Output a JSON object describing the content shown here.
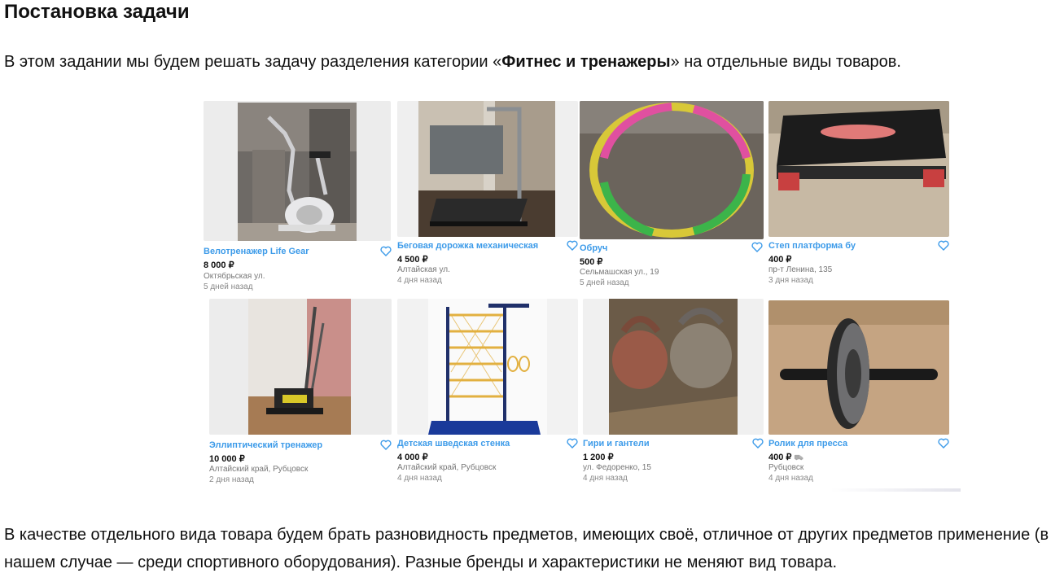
{
  "heading": "Постановка задачи",
  "intro": {
    "before": "В этом задании мы будем решать задачу разделения категории «",
    "bold": "Фитнес и тренажеры",
    "after": "» на отдельные виды товаров."
  },
  "outro": "В качестве отдельного вида товара будем брать разновидность предметов, имеющих своё, отличное от других предметов применение (в нашем случае — среди спортивного оборудования). Разные бренды и характеристики не меняют вид товара.",
  "currency": "₽",
  "listings": [
    {
      "title": "Велотренажер Life Gear",
      "price": "8 000 ₽",
      "address": "Октябрьская ул.",
      "date": "5 дней назад",
      "icon": "exercise-bike"
    },
    {
      "title": "Беговая дорожка механическая",
      "price": "4 500 ₽",
      "address": "Алтайская ул.",
      "date": "4 дня назад",
      "icon": "treadmill"
    },
    {
      "title": "Обруч",
      "price": "500 ₽",
      "address": "Сельмашская ул., 19",
      "date": "5 дней назад",
      "icon": "hula-hoop"
    },
    {
      "title": "Степ платформа бу",
      "price": "400 ₽",
      "address": "пр-т Ленина, 135",
      "date": "3 дня назад",
      "icon": "step-platform"
    },
    {
      "title": "Эллиптический тренажер",
      "price": "10 000 ₽",
      "address": "Алтайский край, Рубцовск",
      "date": "2 дня назад",
      "icon": "elliptical"
    },
    {
      "title": "Детская шведская стенка",
      "price": "4 000 ₽",
      "address": "Алтайский край, Рубцовск",
      "date": "4 дня назад",
      "icon": "wall-bars"
    },
    {
      "title": "Гири и гантели",
      "price": "1 200 ₽",
      "address": "ул. Федоренко, 15",
      "date": "4 дня назад",
      "icon": "kettlebells"
    },
    {
      "title": "Ролик для пресса",
      "price": "400 ₽",
      "address": "Рубцовск",
      "date": "4 дня назад",
      "icon": "ab-roller"
    }
  ]
}
